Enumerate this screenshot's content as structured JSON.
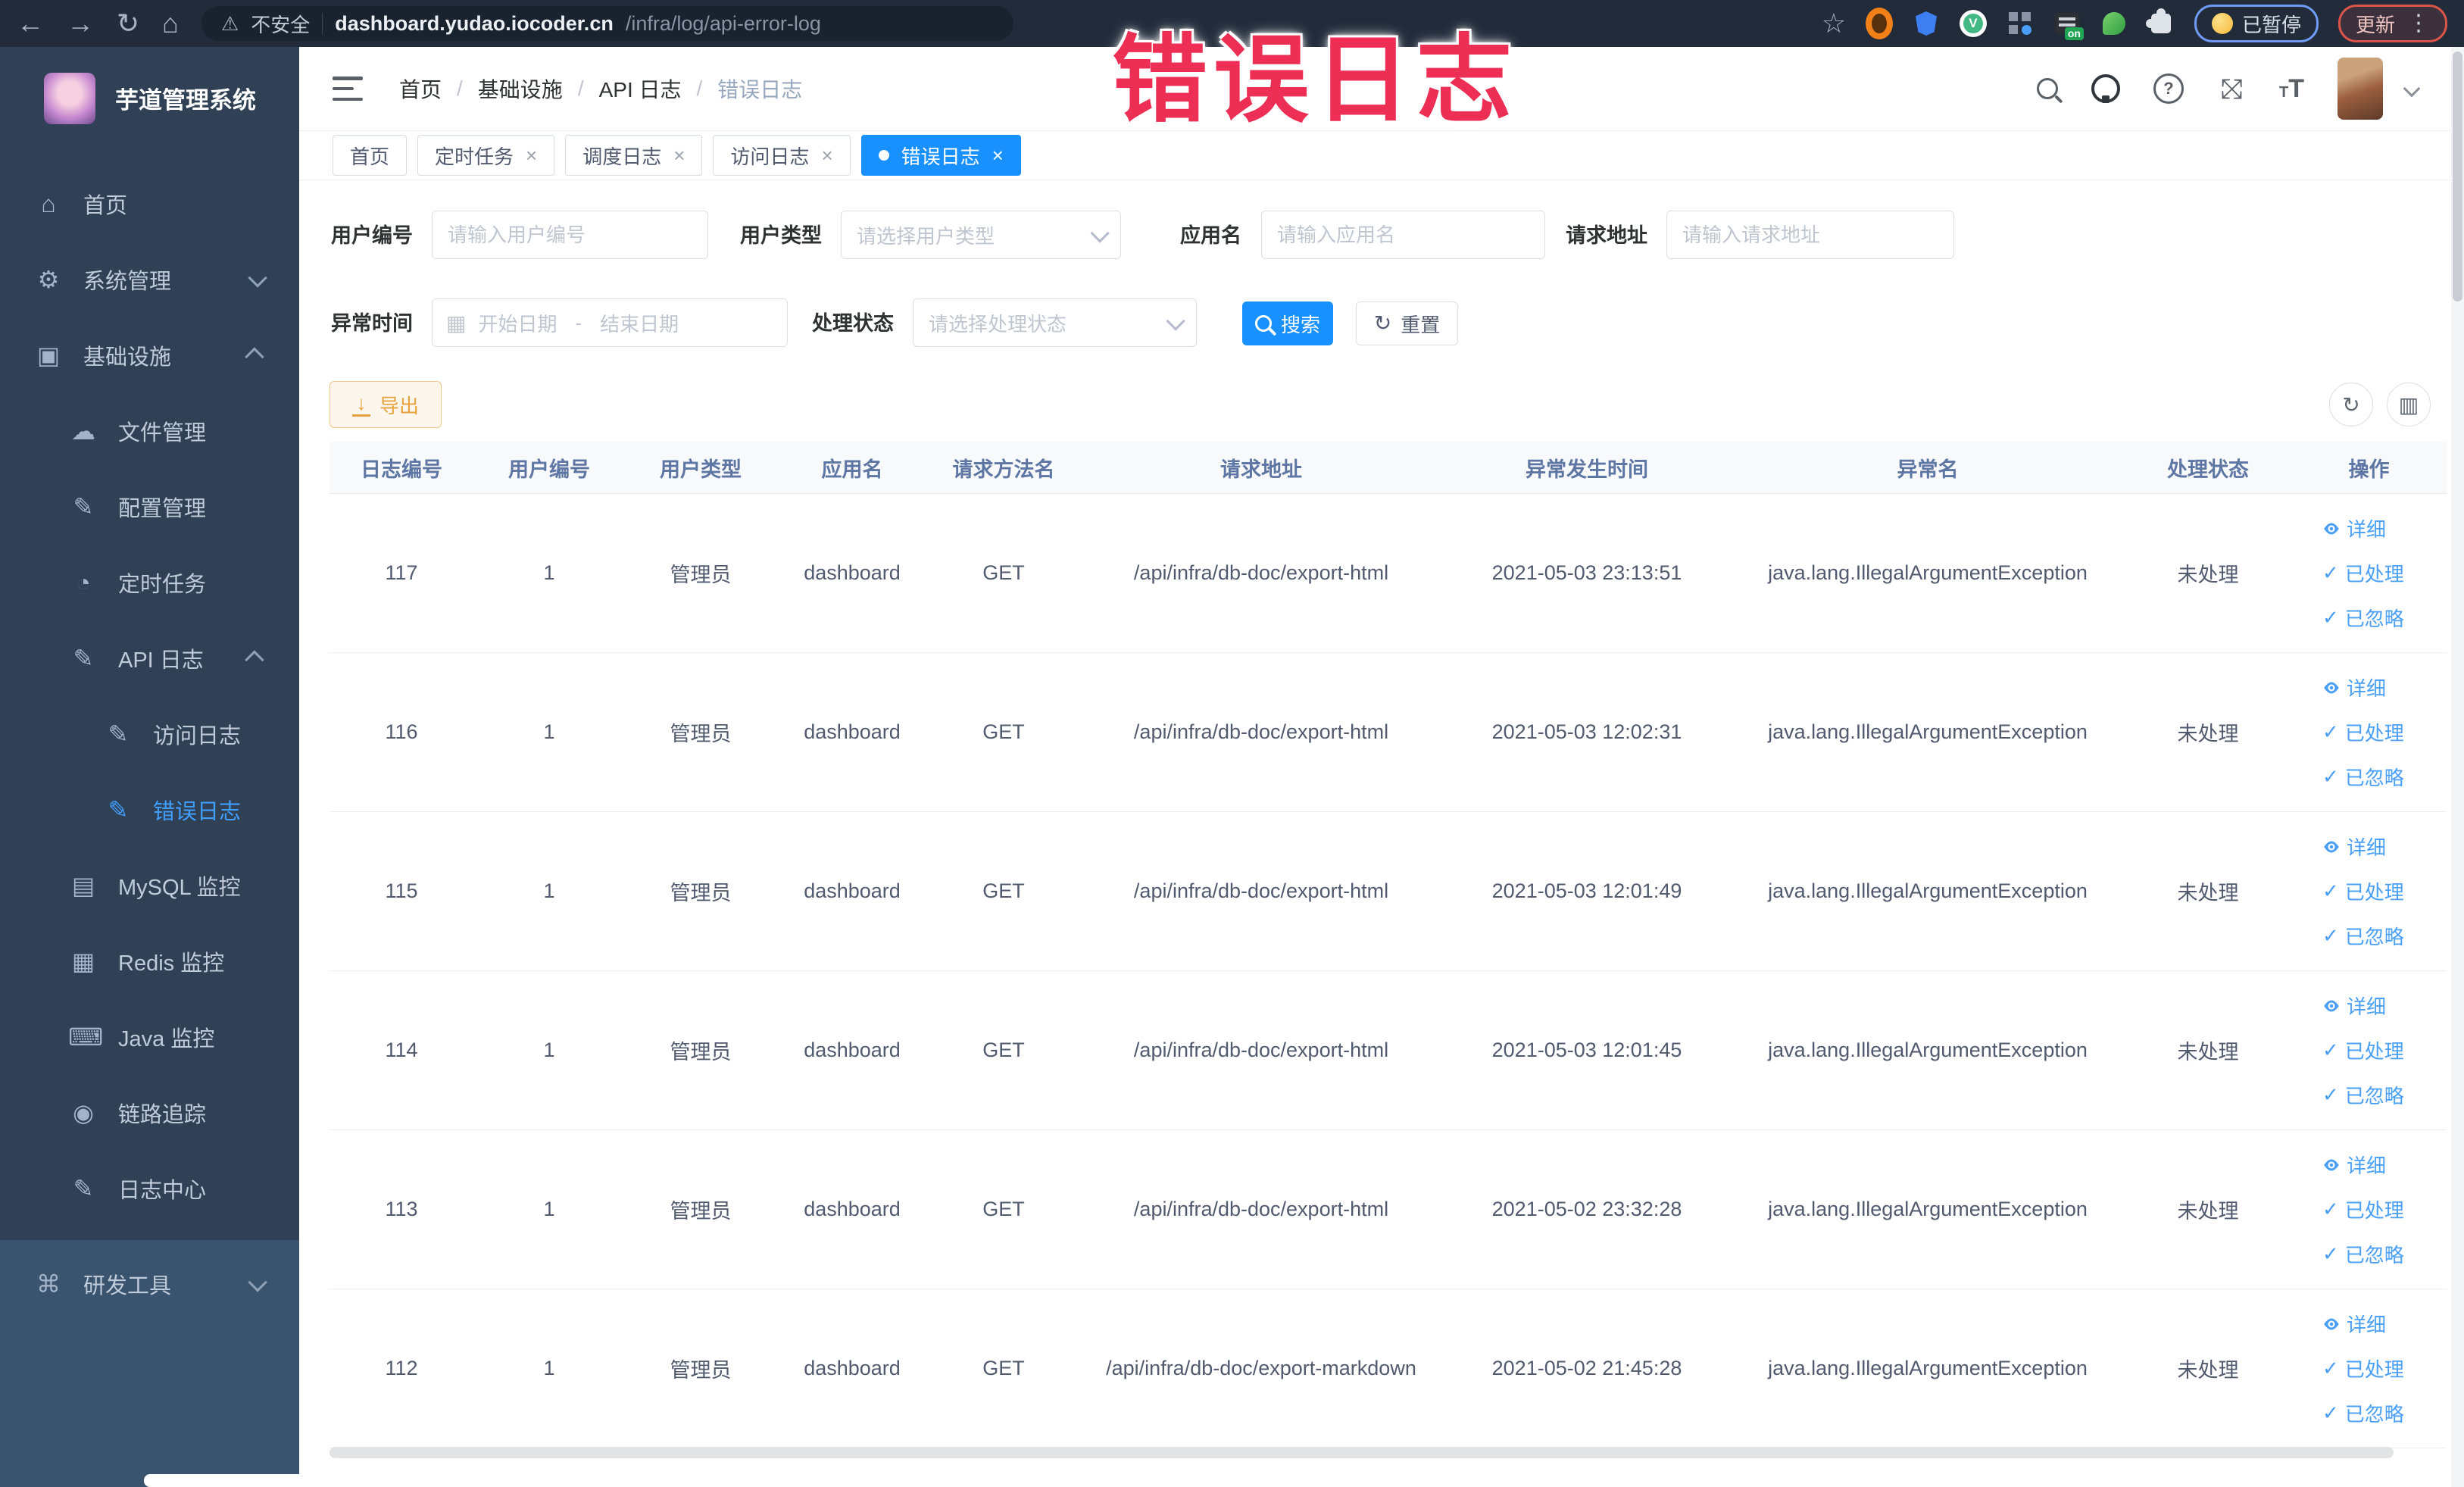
{
  "browser": {
    "security_label": "不安全",
    "url_host": "dashboard.yudao.iocoder.cn",
    "url_path": "/infra/log/api-error-log",
    "paused_badge": "已暂停",
    "update_badge": "更新",
    "nav_icons": [
      "back-icon",
      "forward-icon",
      "reload-icon",
      "home-icon"
    ],
    "extension_icons": [
      "bookmark-star-icon",
      "orange-extension-icon",
      "shield-extension-icon",
      "vue-devtools-icon",
      "grid-extension-icon",
      "on-switch-extension-icon",
      "leaf-extension-icon",
      "puzzle-extensions-icon"
    ]
  },
  "annotation": {
    "text": "错误日志",
    "color": "#ee2f55"
  },
  "sidebar": {
    "title": "芋道管理系统",
    "items": [
      {
        "key": "home",
        "label": "首页",
        "icon": "home-icon",
        "glyph": "⌂",
        "depth": 0
      },
      {
        "key": "system",
        "label": "系统管理",
        "icon": "gear-icon",
        "glyph": "⚙",
        "depth": 0,
        "chevron": "down"
      },
      {
        "key": "infra",
        "label": "基础设施",
        "icon": "monitor-icon",
        "glyph": "▣",
        "depth": 0,
        "chevron": "up"
      },
      {
        "key": "file",
        "label": "文件管理",
        "icon": "cloud-upload-icon",
        "glyph": "☁",
        "depth": 1
      },
      {
        "key": "config",
        "label": "配置管理",
        "icon": "edit-icon",
        "glyph": "✎",
        "depth": 1
      },
      {
        "key": "job",
        "label": "定时任务",
        "icon": "timer-icon",
        "glyph": "◔",
        "depth": 1
      },
      {
        "key": "api-log",
        "label": "API 日志",
        "icon": "log-icon",
        "glyph": "✎",
        "depth": 1,
        "chevron": "up"
      },
      {
        "key": "access-log",
        "label": "访问日志",
        "icon": "log-icon",
        "glyph": "✎",
        "depth": 2
      },
      {
        "key": "error-log",
        "label": "错误日志",
        "icon": "log-icon",
        "glyph": "✎",
        "depth": 2,
        "active": true
      },
      {
        "key": "mysql",
        "label": "MySQL 监控",
        "icon": "database-icon",
        "glyph": "▤",
        "depth": 1
      },
      {
        "key": "redis",
        "label": "Redis 监控",
        "icon": "redis-icon",
        "glyph": "▦",
        "depth": 1
      },
      {
        "key": "java",
        "label": "Java 监控",
        "icon": "java-icon",
        "glyph": "⌨",
        "depth": 1
      },
      {
        "key": "trace",
        "label": "链路追踪",
        "icon": "eye-icon",
        "glyph": "◉",
        "depth": 1
      },
      {
        "key": "log-center",
        "label": "日志中心",
        "icon": "log-center-icon",
        "glyph": "✎",
        "depth": 1
      },
      {
        "key": "dev-tools",
        "label": "研发工具",
        "icon": "toolbox-icon",
        "glyph": "⌘",
        "depth": 0,
        "chevron": "down",
        "section": "light"
      }
    ]
  },
  "breadcrumb": [
    "首页",
    "基础设施",
    "API 日志",
    "错误日志"
  ],
  "tabs": [
    {
      "label": "首页",
      "closable": false,
      "active": false
    },
    {
      "label": "定时任务",
      "closable": true,
      "active": false
    },
    {
      "label": "调度日志",
      "closable": true,
      "active": false
    },
    {
      "label": "访问日志",
      "closable": true,
      "active": false
    },
    {
      "label": "错误日志",
      "closable": true,
      "active": true
    }
  ],
  "header_icons": [
    "search-icon",
    "github-icon",
    "help-icon",
    "fullscreen-icon",
    "font-size-icon",
    "avatar",
    "dropdown-caret-icon"
  ],
  "filters": {
    "user_id": {
      "label": "用户编号",
      "placeholder": "请输入用户编号"
    },
    "user_type": {
      "label": "用户类型",
      "placeholder": "请选择用户类型"
    },
    "app_name": {
      "label": "应用名",
      "placeholder": "请输入应用名"
    },
    "request_url": {
      "label": "请求地址",
      "placeholder": "请输入请求地址"
    },
    "exception_time": {
      "label": "异常时间",
      "start_placeholder": "开始日期",
      "separator": "-",
      "end_placeholder": "结束日期"
    },
    "process_status": {
      "label": "处理状态",
      "placeholder": "请选择处理状态"
    },
    "search_label": "搜索",
    "reset_label": "重置"
  },
  "toolbar": {
    "export_label": "导出"
  },
  "table": {
    "columns": [
      "日志编号",
      "用户编号",
      "用户类型",
      "应用名",
      "请求方法名",
      "请求地址",
      "异常发生时间",
      "异常名",
      "处理状态",
      "操作"
    ],
    "actions": [
      "详细",
      "已处理",
      "已忽略"
    ],
    "rows": [
      {
        "id": "117",
        "user_id": "1",
        "user_type": "管理员",
        "app": "dashboard",
        "method": "GET",
        "url": "/api/infra/db-doc/export-html",
        "time": "2021-05-03 23:13:51",
        "exception": "java.lang.IllegalArgumentException",
        "status": "未处理"
      },
      {
        "id": "116",
        "user_id": "1",
        "user_type": "管理员",
        "app": "dashboard",
        "method": "GET",
        "url": "/api/infra/db-doc/export-html",
        "time": "2021-05-03 12:02:31",
        "exception": "java.lang.IllegalArgumentException",
        "status": "未处理"
      },
      {
        "id": "115",
        "user_id": "1",
        "user_type": "管理员",
        "app": "dashboard",
        "method": "GET",
        "url": "/api/infra/db-doc/export-html",
        "time": "2021-05-03 12:01:49",
        "exception": "java.lang.IllegalArgumentException",
        "status": "未处理"
      },
      {
        "id": "114",
        "user_id": "1",
        "user_type": "管理员",
        "app": "dashboard",
        "method": "GET",
        "url": "/api/infra/db-doc/export-html",
        "time": "2021-05-03 12:01:45",
        "exception": "java.lang.IllegalArgumentException",
        "status": "未处理"
      },
      {
        "id": "113",
        "user_id": "1",
        "user_type": "管理员",
        "app": "dashboard",
        "method": "GET",
        "url": "/api/infra/db-doc/export-html",
        "time": "2021-05-02 23:32:28",
        "exception": "java.lang.IllegalArgumentException",
        "status": "未处理"
      },
      {
        "id": "112",
        "user_id": "1",
        "user_type": "管理员",
        "app": "dashboard",
        "method": "GET",
        "url": "/api/infra/db-doc/export-markdown",
        "time": "2021-05-02 21:45:28",
        "exception": "java.lang.IllegalArgumentException",
        "status": "未处理"
      }
    ]
  },
  "colors": {
    "accent": "#1890ff",
    "link": "#49a0f6",
    "sidebar_bg": "#304156",
    "sidebar_light_bg": "#3a536e",
    "chrome_bg": "#212b3a",
    "annotation": "#ee2f55",
    "warning_text": "#e6a23c",
    "warning_bg": "#fdf6ec"
  }
}
